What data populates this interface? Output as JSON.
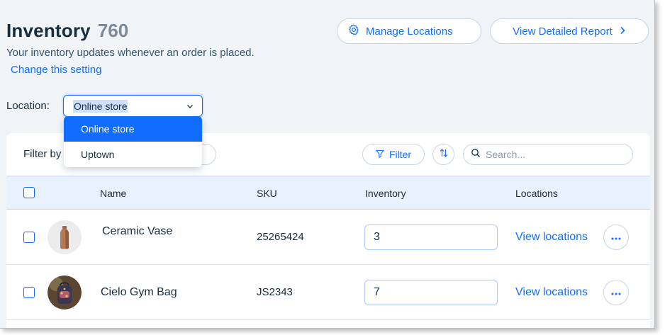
{
  "header": {
    "title": "Inventory",
    "count": "760",
    "subtitle": "Your inventory updates whenever an order is placed.",
    "change_link": "Change this setting",
    "manage_locations": "Manage Locations",
    "view_report": "View Detailed Report"
  },
  "location": {
    "label": "Location:",
    "selected": "Online store",
    "options": [
      "Online store",
      "Uptown"
    ]
  },
  "toolbar": {
    "filter_by": "Filter by",
    "filter": "Filter",
    "search_placeholder": "Search..."
  },
  "table": {
    "columns": [
      "Name",
      "SKU",
      "Inventory",
      "Locations"
    ],
    "rows": [
      {
        "name": "Ceramic Vase",
        "sku": "25265424",
        "inventory": "3",
        "locations": "View locations"
      },
      {
        "name": "Cielo Gym Bag",
        "sku": "JS2343",
        "inventory": "7",
        "locations": "View locations"
      }
    ]
  },
  "colors": {
    "accent": "#116dff",
    "header_bg": "#e9f1fd",
    "page_bg": "#f0f4f7",
    "text": "#162d3d"
  }
}
